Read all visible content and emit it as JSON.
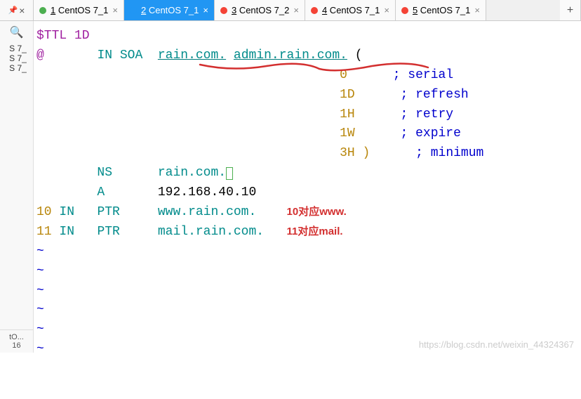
{
  "tabs": {
    "items": [
      {
        "num": "1",
        "name": "CentOS 7_1",
        "dot": "green",
        "active": false
      },
      {
        "num": "2",
        "name": "CentOS 7_1",
        "dot": "blue",
        "active": true
      },
      {
        "num": "3",
        "name": "CentOS 7_2",
        "dot": "red",
        "active": false
      },
      {
        "num": "4",
        "name": "CentOS 7_1",
        "dot": "red",
        "active": false
      },
      {
        "num": "5",
        "name": "CentOS 7_1",
        "dot": "red",
        "active": false
      }
    ],
    "pin_close": "×",
    "new_tab": "+"
  },
  "sidebar": {
    "items": [
      "S 7_",
      "S 7_",
      "S 7_"
    ],
    "bottom": [
      "tO...",
      "16"
    ]
  },
  "code": {
    "l1_ttl": "$TTL 1D",
    "l2_at": "@",
    "l2_in": "IN",
    "l2_soa": "SOA",
    "l2_ns1": "rain.com.",
    "l2_admin": "admin.rain.com.",
    "l2_paren": " (",
    "soa": [
      {
        "val": "0",
        "comment": "; serial"
      },
      {
        "val": "1D",
        "comment": "; refresh"
      },
      {
        "val": "1H",
        "comment": "; retry"
      },
      {
        "val": "1W",
        "comment": "; expire"
      },
      {
        "val": "3H )",
        "comment": "; minimum"
      }
    ],
    "ns_type": "NS",
    "ns_val": "rain.com.",
    "a_type": "A",
    "a_val": "192.168.40.10",
    "ptr1_num": "10",
    "ptr1_in": "IN",
    "ptr1_type": "PTR",
    "ptr1_val": "www.rain.com.",
    "ptr2_num": "11",
    "ptr2_in": "IN",
    "ptr2_type": "PTR",
    "ptr2_val": "mail.rain.com.",
    "tilde": "~"
  },
  "annotations": {
    "www": "10对应www.",
    "mail": "11对应mail."
  },
  "watermark": "https://blog.csdn.net/weixin_44324367"
}
